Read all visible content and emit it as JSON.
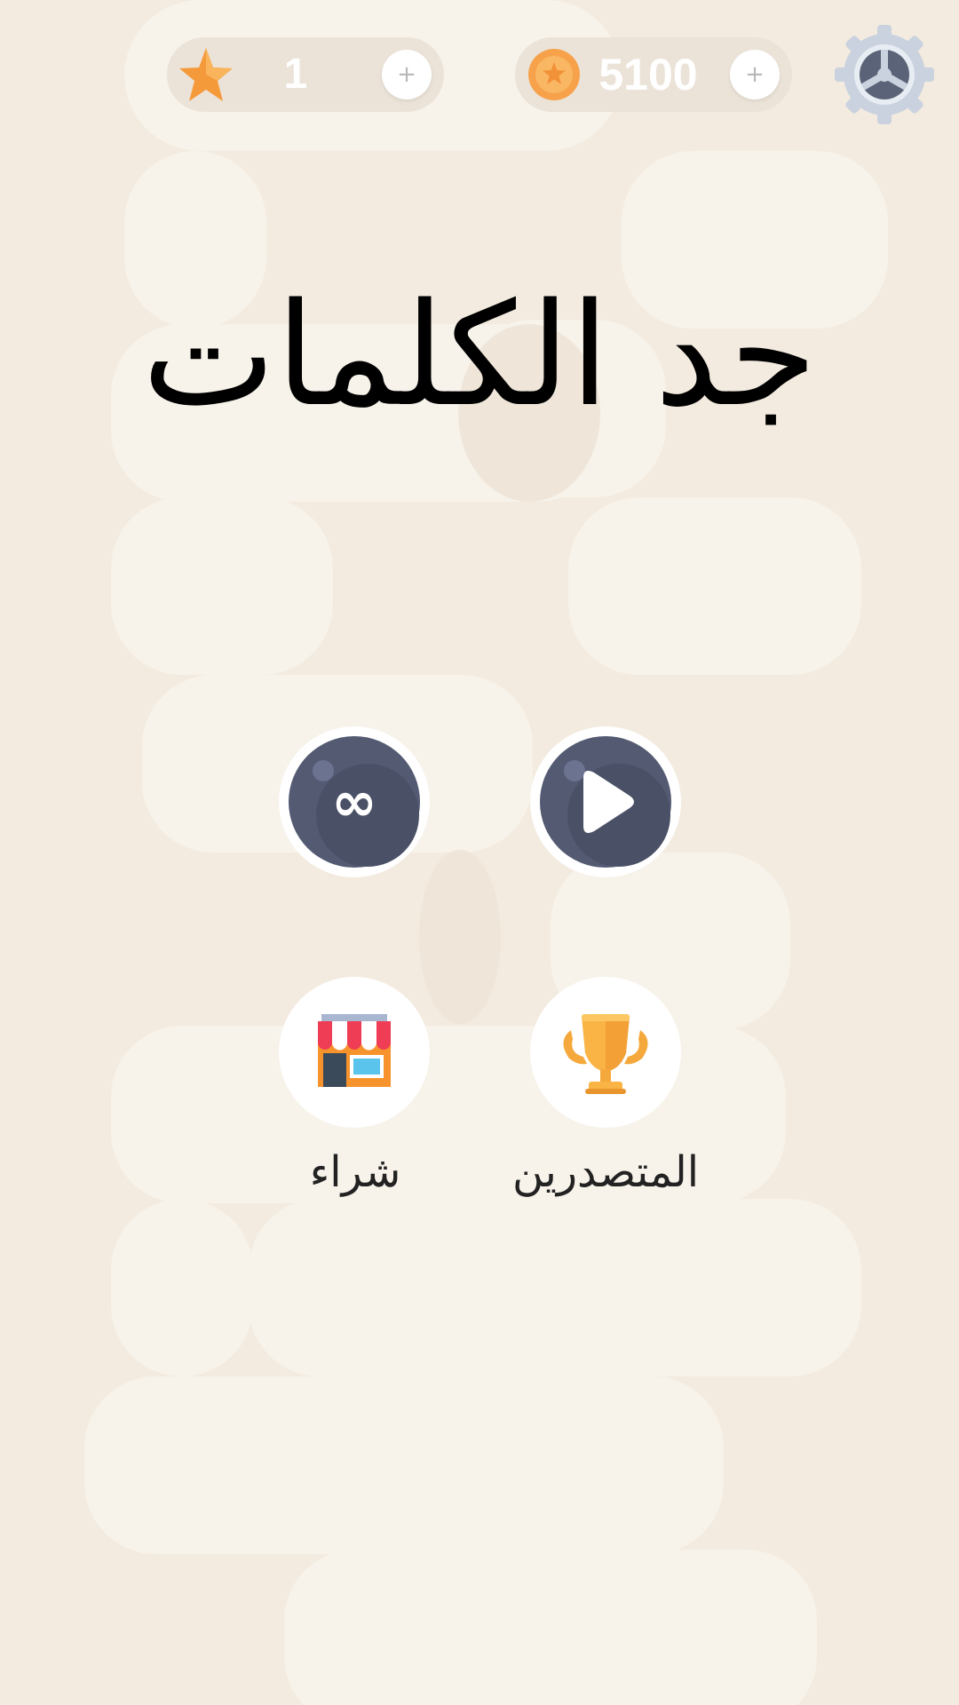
{
  "app": {
    "title": "جد الكلمات"
  },
  "topbar": {
    "stars": {
      "icon": "star-icon",
      "value": "1",
      "plus": "+"
    },
    "coins": {
      "icon": "coin-icon",
      "value": "5100",
      "plus": "+"
    },
    "settings": {
      "icon": "gear-icon"
    }
  },
  "menu": {
    "play": {
      "icon": "play-icon"
    },
    "infinite": {
      "icon": "infinity-icon",
      "symbol": "∞"
    },
    "leaderboard": {
      "icon": "trophy-icon",
      "label": "المتصدرين"
    },
    "shop": {
      "icon": "shop-icon",
      "label": "شراء"
    }
  },
  "colors": {
    "background": "#f3ebdf",
    "button_dark": "#535a72",
    "star": "#f59a3a",
    "coin": "#f7a24b"
  }
}
